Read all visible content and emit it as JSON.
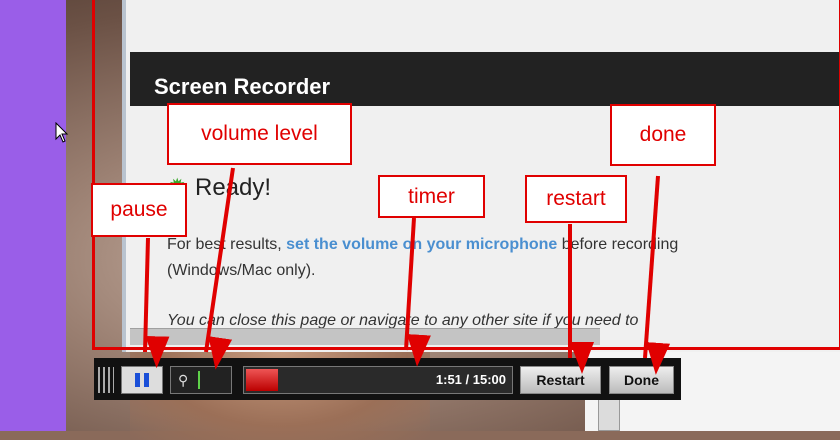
{
  "app": {
    "title": "Screen Recorder",
    "status": "Ready!",
    "instructions": {
      "prefix": "For best results, ",
      "link": "set the volume on your microphone",
      "suffix": " before recording",
      "line2": "(Windows/Mac only).",
      "line3": "You can close this page or navigate to any other site if you need to"
    }
  },
  "toolbar": {
    "timer": "1:51 / 15:00",
    "progress": 0.123,
    "restart_label": "Restart",
    "done_label": "Done"
  },
  "annotations": {
    "volume": "volume level",
    "pause": "pause",
    "timer": "timer",
    "restart": "restart",
    "done": "done"
  },
  "colors": {
    "annotation": "#e00000",
    "side_panel": "#9a5ee8",
    "link": "#4a8fd0",
    "status_icon": "#39a82c"
  },
  "icons": {
    "pause": "pause-icon",
    "volume": "microphone-icon",
    "status": "gear-icon",
    "cursor": "mouse-pointer-icon"
  }
}
